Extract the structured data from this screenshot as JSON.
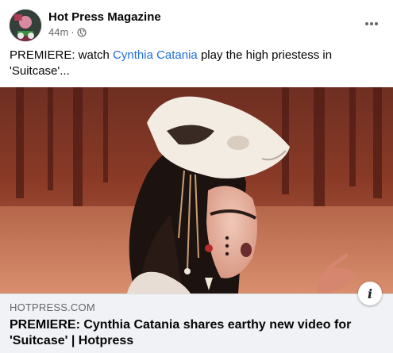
{
  "post": {
    "page_name": "Hot Press Magazine",
    "time": "44m",
    "separator": "·",
    "text_prefix": "PREMIERE: watch ",
    "mention": "Cynthia Catania",
    "text_suffix": " play the high priestess in 'Suitcase'...",
    "more_icon": "ellipsis-icon",
    "audience_icon": "globe-icon"
  },
  "media": {
    "image_desc_icon": "music-video-still",
    "info_label": "i"
  },
  "link_preview": {
    "domain": "HOTPRESS.COM",
    "title": "PREMIERE: Cynthia Catania shares earthy new video for 'Suitcase' | Hotpress"
  },
  "colors": {
    "mention": "#216fdb",
    "secondary_text": "#65676b",
    "preview_bg": "#f0f2f5"
  }
}
